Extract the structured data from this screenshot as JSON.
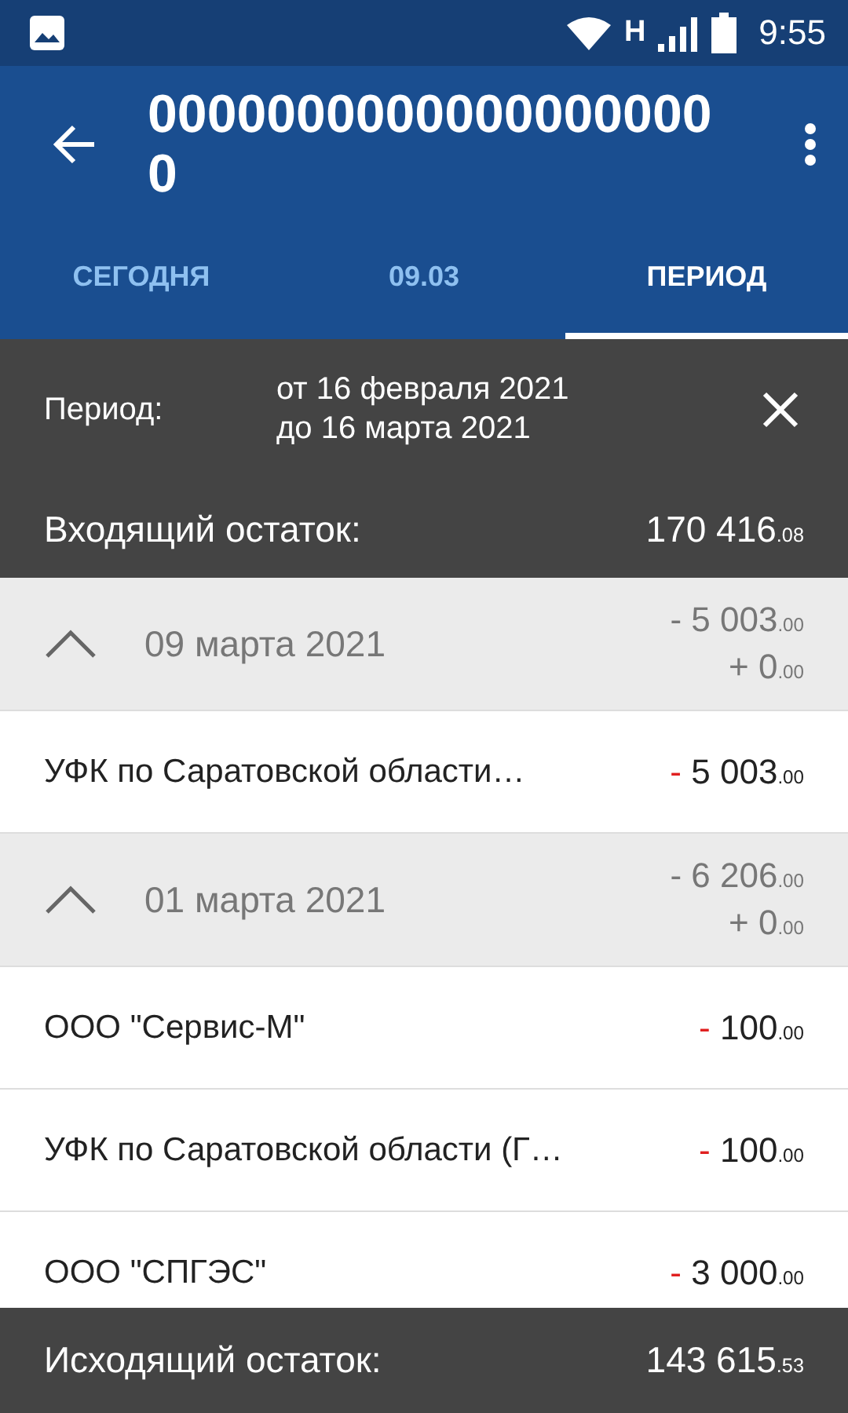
{
  "status_bar": {
    "network": "H",
    "time": "9:55"
  },
  "app_bar": {
    "title": "00000000000000000000"
  },
  "tabs": [
    {
      "label": "СЕГОДНЯ",
      "selected": false
    },
    {
      "label": "09.03",
      "selected": false
    },
    {
      "label": "ПЕРИОД",
      "selected": true
    }
  ],
  "period": {
    "label": "Период:",
    "from": "от 16 февраля 2021",
    "to": "до 16 марта 2021"
  },
  "opening_balance": {
    "label": "Входящий остаток:",
    "main": "170 416",
    "cents": ".08"
  },
  "groups": [
    {
      "date": "09 марта 2021",
      "expanded": true,
      "debit": {
        "main": "- 5 003",
        "cents": ".00"
      },
      "credit": {
        "main": "+ 0",
        "cents": ".00"
      },
      "rows": [
        {
          "name": "УФК по Саратовской области…",
          "sign": "-",
          "main": "5 003",
          "cents": ".00"
        }
      ]
    },
    {
      "date": "01 марта 2021",
      "expanded": true,
      "debit": {
        "main": "- 6 206",
        "cents": ".00"
      },
      "credit": {
        "main": "+ 0",
        "cents": ".00"
      },
      "rows": [
        {
          "name": "ООО \"Сервис-М\"",
          "sign": "-",
          "main": "100",
          "cents": ".00"
        },
        {
          "name": "УФК по Саратовской области (Г…",
          "sign": "-",
          "main": "100",
          "cents": ".00"
        },
        {
          "name": "ООО \"СПГЭС\"",
          "sign": "-",
          "main": "3 000",
          "cents": ".00"
        }
      ]
    }
  ],
  "closing_balance": {
    "label": "Исходящий остаток:",
    "main": "143 615",
    "cents": ".53"
  }
}
